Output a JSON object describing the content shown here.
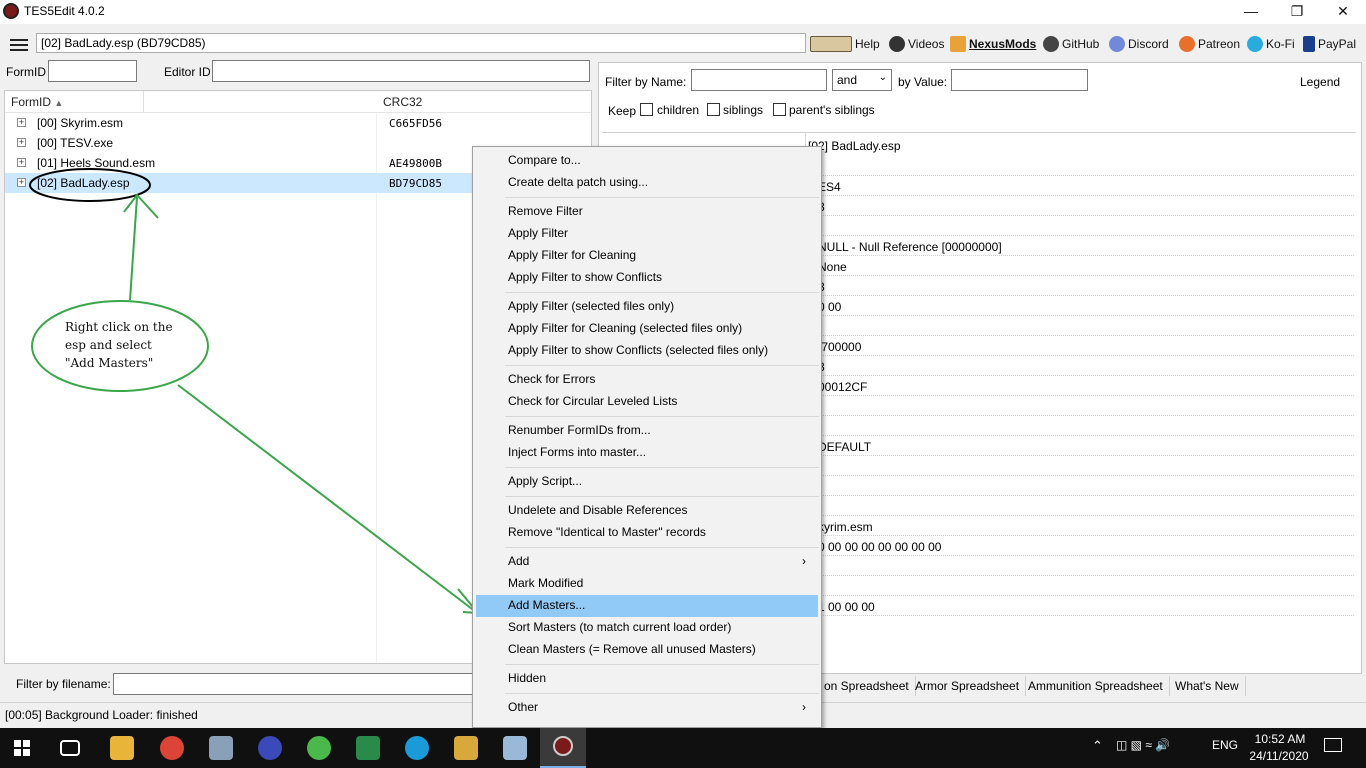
{
  "window": {
    "title": "TES5Edit 4.0.2"
  },
  "toolbar": {
    "path": "[02] BadLady.esp (BD79CD85)",
    "links": [
      {
        "label": "Help",
        "icon": "book-icon"
      },
      {
        "label": "Videos",
        "icon": "videos-icon"
      },
      {
        "label": "NexusMods",
        "icon": "nexusmods-icon"
      },
      {
        "label": "GitHub",
        "icon": "github-icon"
      },
      {
        "label": "Discord",
        "icon": "discord-icon"
      },
      {
        "label": "Patreon",
        "icon": "patreon-icon"
      },
      {
        "label": "Ko-Fi",
        "icon": "kofi-icon"
      },
      {
        "label": "PayPal",
        "icon": "paypal-icon"
      }
    ]
  },
  "left_filters": {
    "formid_label": "FormID",
    "editorid_label": "Editor ID"
  },
  "tree": {
    "col_formid": "FormID",
    "col_crc": "CRC32",
    "rows": [
      {
        "name": "[00] Skyrim.esm",
        "crc": "C665FD56"
      },
      {
        "name": "[00] TESV.exe",
        "crc": ""
      },
      {
        "name": "[01] Heels Sound.esm",
        "crc": "AE49800B"
      },
      {
        "name": "[02] BadLady.esp",
        "crc": "BD79CD85"
      }
    ]
  },
  "filename_filter": {
    "label": "Filter by filename:"
  },
  "right_panel": {
    "filter_name_label": "Filter by Name:",
    "and_option": "and",
    "by_value_label": "by Value:",
    "legend": "Legend",
    "keep_label": "Keep",
    "cb_children": "children",
    "cb_siblings": "siblings",
    "cb_parents": "parent's siblings",
    "header_value": "[02] BadLady.esp",
    "values": [
      "",
      "ES4",
      "3",
      "",
      "NULL - Null Reference [00000000]",
      "None",
      "3",
      "0 00",
      "",
      ".700000",
      "3",
      "00012CF",
      "",
      "",
      "DEFAULT",
      "",
      "",
      "",
      "kyrim.esm",
      "0 00 00 00 00 00 00 00",
      "",
      "",
      "1 00 00 00"
    ]
  },
  "tabs": [
    "on Spreadsheet",
    "Armor Spreadsheet",
    "Ammunition Spreadsheet",
    "What's New"
  ],
  "status": "[00:05] Background Loader: finished",
  "context_menu": {
    "items": [
      "Compare to...",
      "Create delta patch using...",
      "Remove Filter",
      "Apply Filter",
      "Apply Filter for Cleaning",
      "Apply Filter to show Conflicts",
      "Apply Filter (selected files only)",
      "Apply Filter for Cleaning (selected files only)",
      "Apply Filter to show Conflicts (selected files only)",
      "Check for Errors",
      "Check for Circular Leveled Lists",
      "Renumber FormIDs from...",
      "Inject Forms into master...",
      "Apply Script...",
      "Undelete and Disable References",
      "Remove \"Identical to Master\" records",
      "Add",
      "Mark Modified",
      "Add Masters...",
      "Sort Masters (to match current load order)",
      "Clean Masters (= Remove all unused Masters)",
      "Hidden",
      "Other"
    ]
  },
  "annotation": {
    "line1": "Right click on the",
    "line2": "esp and select",
    "line3": "\"Add Masters\""
  },
  "taskbar": {
    "time": "10:52 AM",
    "date": "24/11/2020",
    "lang": "ENG"
  },
  "colors": {
    "menu_highlight": "#91c9f7",
    "tree_selected": "#cce8ff",
    "annotation_green": "#3aa64a"
  }
}
